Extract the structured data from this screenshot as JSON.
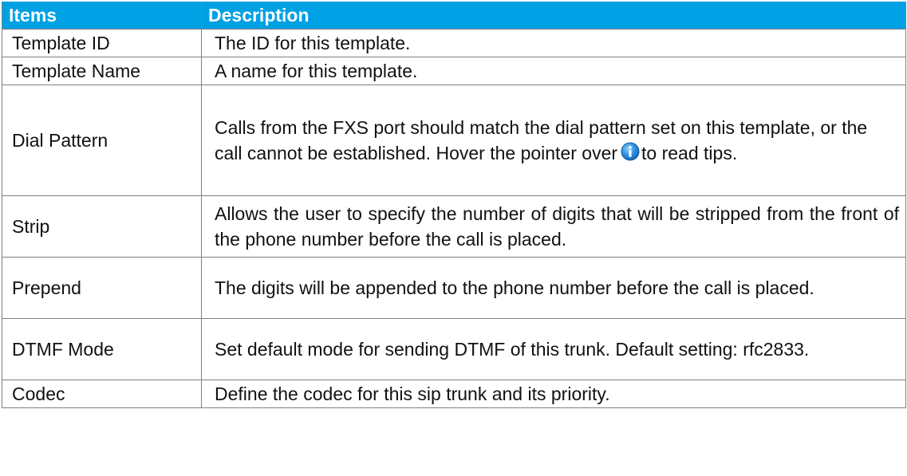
{
  "table": {
    "headers": {
      "items": "Items",
      "description": "Description"
    },
    "rows": [
      {
        "item": "Template ID",
        "description": "The ID for this template."
      },
      {
        "item": "Template Name",
        "description": "A name for this template."
      },
      {
        "item": "Dial Pattern",
        "description_before_icon": "Calls from the FXS port should match the dial pattern set on this template, or the call cannot be established. Hover the pointer over",
        "description_after_icon": "to read tips.",
        "icon": "info-icon"
      },
      {
        "item": "Strip",
        "description": "Allows the user to specify the number of digits that will be stripped from the front of the phone number before the call is placed."
      },
      {
        "item": "Prepend",
        "description": "The digits will be appended to the phone number before the call is placed."
      },
      {
        "item": "DTMF Mode",
        "description": "Set default mode for sending DTMF of this trunk. Default setting: rfc2833."
      },
      {
        "item": "Codec",
        "description": "Define the codec for this sip trunk and its priority."
      }
    ]
  },
  "colors": {
    "header_background": "#00a0e4",
    "header_text": "#ffffff",
    "border": "#7f7f7f",
    "info_icon": "#2f8fe0"
  }
}
